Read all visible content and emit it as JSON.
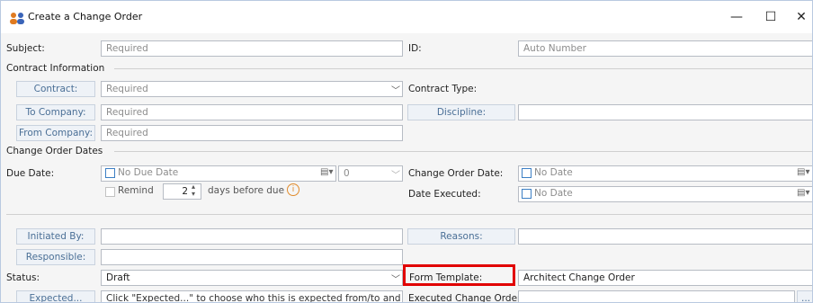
{
  "window": {
    "title": "Create a Change Order",
    "minimize": "—",
    "maximize": "☐",
    "close": "✕"
  },
  "form": {
    "subject": {
      "label": "Subject:",
      "placeholder": "Required"
    },
    "id": {
      "label": "ID:",
      "value": "Auto Number"
    },
    "contract_info_header": "Contract Information",
    "contract": {
      "button": "Contract:",
      "placeholder": "Required"
    },
    "contract_type": {
      "label": "Contract Type:"
    },
    "to_company": {
      "button": "To Company:",
      "placeholder": "Required"
    },
    "discipline": {
      "button": "Discipline:",
      "value": ""
    },
    "from_company": {
      "button": "From Company:",
      "placeholder": "Required"
    },
    "dates_header": "Change Order Dates",
    "due_date": {
      "label": "Due Date:",
      "checkbox_label": "No Due Date",
      "days_value": "0"
    },
    "remind": {
      "label": "Remind",
      "value": "2",
      "suffix": "days before due",
      "info": "i"
    },
    "change_order_date": {
      "label": "Change Order Date:",
      "checkbox_label": "No Date"
    },
    "date_executed": {
      "label": "Date Executed:",
      "checkbox_label": "No Date"
    },
    "initiated_by": {
      "button": "Initiated By:",
      "value": ""
    },
    "reasons": {
      "button": "Reasons:",
      "value": ""
    },
    "responsible": {
      "button": "Responsible:",
      "value": ""
    },
    "status": {
      "label": "Status:",
      "value": "Draft"
    },
    "form_template": {
      "label": "Form Template:",
      "value": "Architect Change Order"
    },
    "expected": {
      "button": "Expected...",
      "value": "Click \"Expected...\" to choose who this is expected from/to and w"
    },
    "executed_change_order": {
      "label": "Executed Change Order:",
      "value": "",
      "button": "..."
    }
  },
  "colors": {
    "highlight": "#e10000",
    "button_text": "#4a6f96",
    "checkbox_border": "#3c7fc4"
  }
}
